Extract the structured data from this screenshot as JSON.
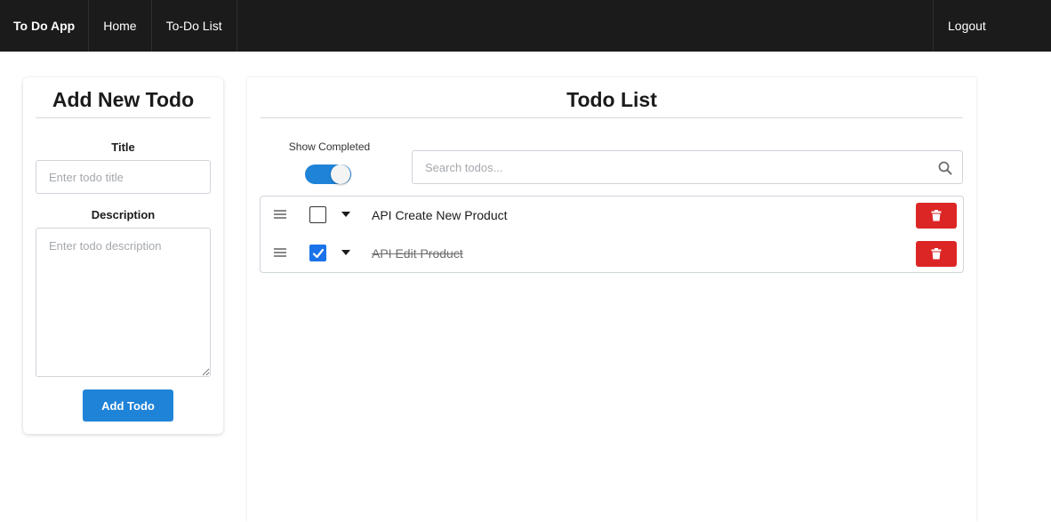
{
  "navbar": {
    "brand": "To Do App",
    "links": [
      "Home",
      "To-Do List"
    ],
    "logout": "Logout"
  },
  "add_form": {
    "title": "Add New Todo",
    "title_label": "Title",
    "title_placeholder": "Enter todo title",
    "description_label": "Description",
    "description_placeholder": "Enter todo description",
    "submit_label": "Add Todo"
  },
  "todo_list": {
    "title": "Todo List",
    "show_completed_label": "Show Completed",
    "show_completed": true,
    "search_placeholder": "Search todos...",
    "items": [
      {
        "title": "API Create New Product",
        "completed": false
      },
      {
        "title": "API Edit Product",
        "completed": true
      }
    ]
  },
  "colors": {
    "navbar_bg": "#1b1b1c",
    "primary": "#1f83d8",
    "danger": "#dc2626",
    "checkbox_checked": "#1a73e8"
  }
}
